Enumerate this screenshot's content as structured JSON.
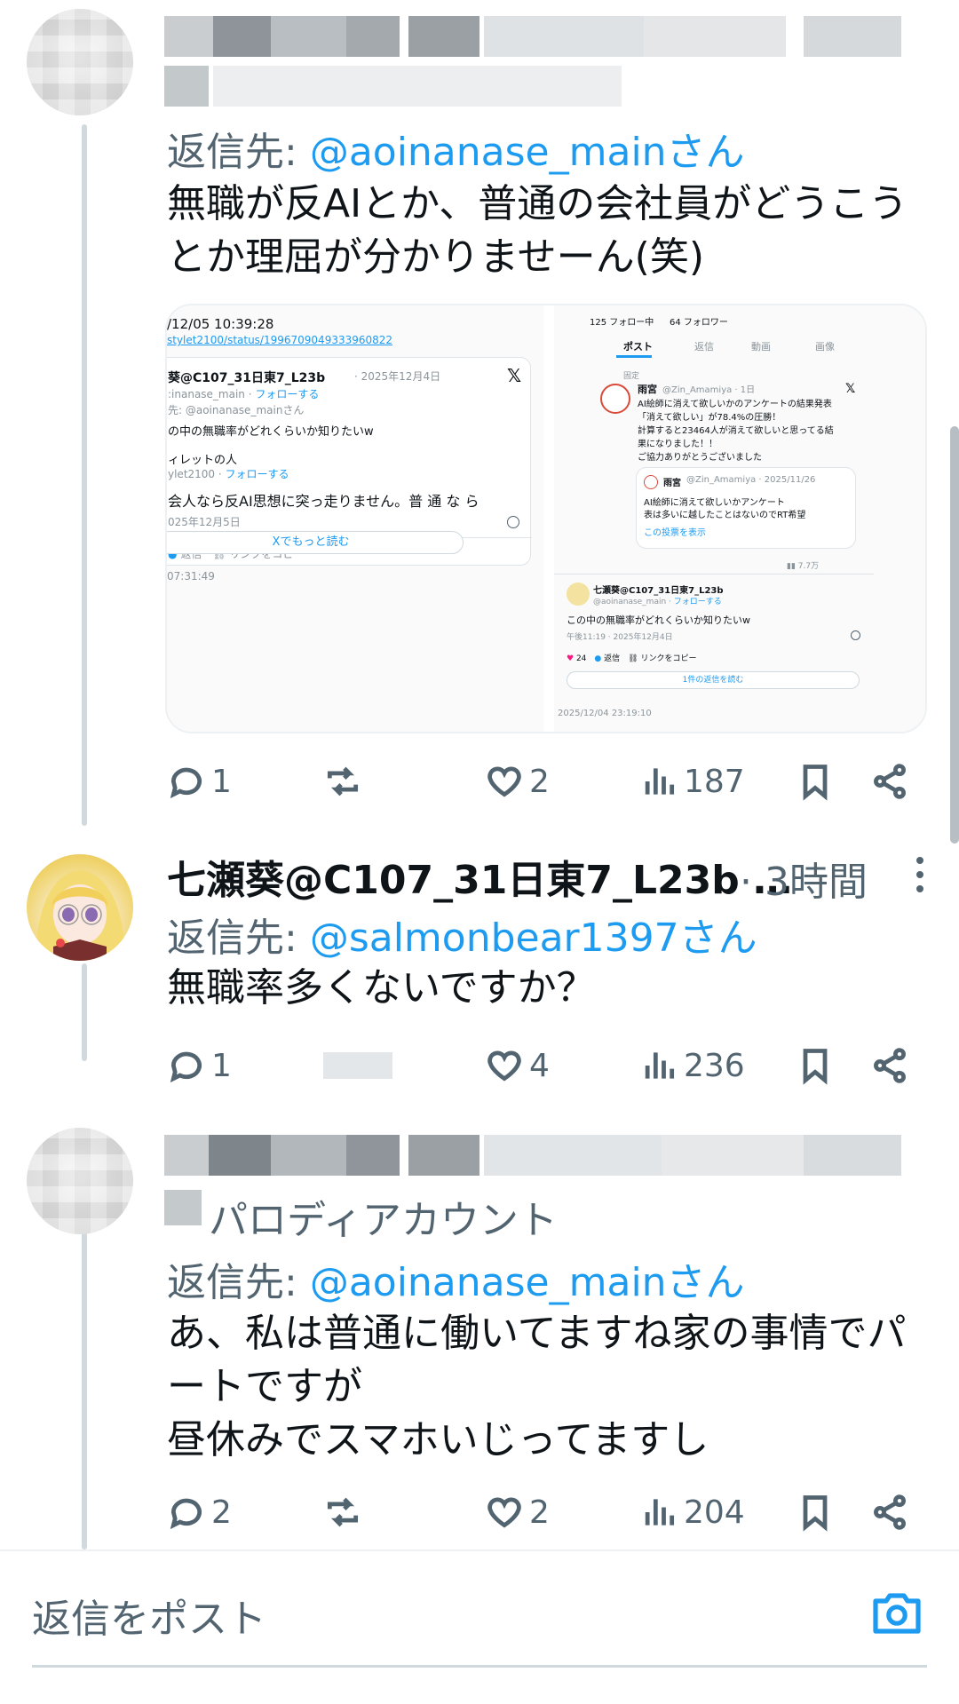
{
  "posts": [
    {
      "reply_to_prefix": "返信先: ",
      "reply_to_handle": "@aoinanase_mainさん",
      "text": "無職が反AIとか、普通の会社員がどうこうとか理屈が分かりませーん(笑)",
      "media": {
        "left": {
          "timestamp_top": "/12/05 10:39:28",
          "link": "stylet2100/status/1996709049333960822",
          "card_name": "葵@C107_31日東7_L23b",
          "card_date": "· 2025年12月4日",
          "card_handle": ":inanase_main · ",
          "card_follow": "フォローする",
          "card_reply": "先: @aoinanase_mainさん",
          "card_line1": "の中の無職率がどれくらいか知りたいw",
          "quote_name": "ィレットの人",
          "quote_handle": "ylet2100 · ",
          "quote_follow": "フォローする",
          "quote_text": "会人なら反AI思想に突っ走りません。普 通 な ら",
          "quote_date": "025年12月5日",
          "reply_label": "返信",
          "copy_link_label": "リンクをコピー",
          "read_more": "Xでもっと読む",
          "timestamp_bottom": "07:31:49"
        },
        "right": {
          "following": "125 フォロー中",
          "followers": "64 フォロワー",
          "tabs": [
            "ポスト",
            "返信",
            "動画",
            "画像"
          ],
          "pinned": "固定",
          "poster_name": "雨宮",
          "poster_handle": "@Zin_Amamiya · 1日",
          "lines": [
            "AI絵師に消えて欲しいかのアンケートの結果発表",
            "「消えて欲しい」が78.4%の圧勝！",
            "計算すると23464人が消えて欲しいと思ってる結",
            "果になりました！！",
            "ご協力ありがとうございました"
          ],
          "quote_name": "雨宮",
          "quote_handle": "@Zin_Amamiya · 2025/11/26",
          "quote_lines": [
            "AI絵師に消えて欲しいかアンケート",
            "表は多いに越したことはないのでRT希望"
          ],
          "show_poll": "この投票を表示",
          "views": "7.7万",
          "reply_name": "七瀬葵@C107_31日東7_L23b",
          "reply_handle": "@aoinanase_main · ",
          "reply_follow": "フォローする",
          "reply_text": "この中の無職率がどれくらいか知りたいw",
          "reply_time": "午後11:19 · 2025年12月4日",
          "likes": "24",
          "reply_label": "返信",
          "copy_link_label": "リンクをコピー",
          "read_replies": "1件の返信を読む",
          "timestamp_bottom": "2025/12/04 23:19:10"
        }
      },
      "stats": {
        "replies": "1",
        "likes": "2",
        "views": "187"
      }
    },
    {
      "author_name": "七瀬葵@C107_31日東7_L23b …",
      "time": "· 3時間",
      "reply_to_prefix": "返信先: ",
      "reply_to_handle": "@salmonbear1397さん",
      "text": "無職率多くないですか？",
      "stats": {
        "replies": "1",
        "likes": "4",
        "views": "236"
      }
    },
    {
      "subtitle": "パロディアカウント",
      "reply_to_prefix": "返信先: ",
      "reply_to_handle": "@aoinanase_mainさん",
      "text_lines": [
        "あ、私は普通に働いてますね家の事情でパートですが",
        "昼休みでスマホいじってますし"
      ],
      "stats": {
        "replies": "2",
        "likes": "2",
        "views": "204"
      }
    }
  ],
  "composer": {
    "placeholder": "返信をポスト"
  },
  "icons": {
    "reply": "reply-icon",
    "retweet": "retweet-icon",
    "like": "heart-icon",
    "views": "views-icon",
    "bookmark": "bookmark-icon",
    "share": "share-icon",
    "camera": "camera-icon"
  },
  "colors": {
    "accent": "#1d9bf0",
    "muted": "#536471",
    "text": "#0f1419"
  }
}
